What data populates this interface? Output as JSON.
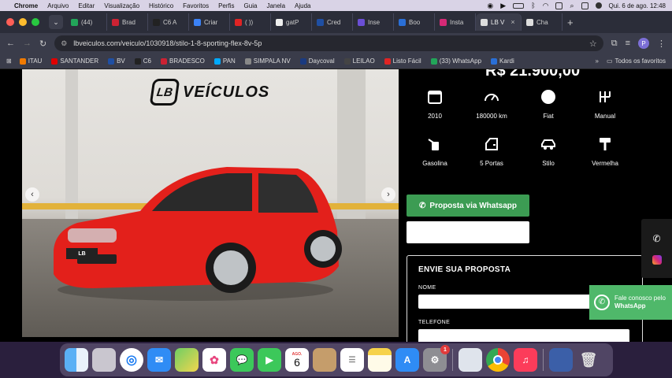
{
  "menubar": {
    "items": [
      "Chrome",
      "Arquivo",
      "Editar",
      "Visualização",
      "Histórico",
      "Favoritos",
      "Perfis",
      "Guia",
      "Janela",
      "Ajuda"
    ],
    "clock": "Qui. 6 de ago.  12:48"
  },
  "tabs": [
    {
      "label": "(44)",
      "color": "#22a559"
    },
    {
      "label": "Brad",
      "color": "#cc2233"
    },
    {
      "label": "C6 A",
      "color": "#222222"
    },
    {
      "label": "Criar",
      "color": "#3b82f6"
    },
    {
      "label": "( ))",
      "color": "#e02424"
    },
    {
      "label": "gatP",
      "color": "#eeeeee"
    },
    {
      "label": "Cred",
      "color": "#1f4fa3"
    },
    {
      "label": "Inse",
      "color": "#6b4fd6"
    },
    {
      "label": "Boo",
      "color": "#2a6fd6"
    },
    {
      "label": "Insta",
      "color": "#d62976"
    },
    {
      "label": "LB V",
      "color": "#dddddd",
      "active": true
    },
    {
      "label": "Cha",
      "color": "#dddddd"
    }
  ],
  "address": {
    "url": "lbveiculos.com/veiculo/1030918/stilo-1-8-sporting-flex-8v-5p",
    "profile_initial": "P"
  },
  "bookmarks": {
    "items": [
      {
        "label": "ITAU",
        "color": "#f07a00"
      },
      {
        "label": "SANTANDER",
        "color": "#e00000"
      },
      {
        "label": "BV",
        "color": "#1f4fa3"
      },
      {
        "label": "C6",
        "color": "#222222"
      },
      {
        "label": "BRADESCO",
        "color": "#cc2233"
      },
      {
        "label": "PAN",
        "color": "#00aaff"
      },
      {
        "label": "SIMPALA NV",
        "color": "#888888"
      },
      {
        "label": "Daycoval",
        "color": "#1a3a80"
      },
      {
        "label": "LEILAO",
        "color": "#444444"
      },
      {
        "label": "Listo Fácil",
        "color": "#e02424"
      },
      {
        "label": "(33) WhatsApp",
        "color": "#22a559"
      },
      {
        "label": "Kardi",
        "color": "#2a6fd6"
      }
    ],
    "more": "»",
    "folder": "Todos os favoritos"
  },
  "listing": {
    "logo_badge": "LB",
    "logo_word": "VEÍCULOS",
    "price": "R$ 21.900,00",
    "plate_text": "LB",
    "specs": [
      {
        "label": "2010",
        "icon": "calendar-icon"
      },
      {
        "label": "180000 km",
        "icon": "speedometer-icon"
      },
      {
        "label": "Fiat",
        "icon": "brand-icon"
      },
      {
        "label": "Manual",
        "icon": "gearshift-icon"
      },
      {
        "label": "Gasolina",
        "icon": "fuel-icon"
      },
      {
        "label": "5 Portas",
        "icon": "door-icon"
      },
      {
        "label": "Stilo",
        "icon": "car-icon"
      },
      {
        "label": "Vermelha",
        "icon": "paint-roller-icon"
      }
    ],
    "whatsapp_button": "Proposta via Whatsapp",
    "form": {
      "title": "ENVIE SUA PROPOSTA",
      "name_label": "NOME",
      "phone_label": "TELEFONE"
    },
    "float_whatsapp": {
      "line1": "Fale conosco pelo",
      "line2": "WhatsApp"
    }
  },
  "dock": {
    "calendar_month": "AGO.",
    "calendar_day": "6",
    "settings_badge": "1"
  }
}
